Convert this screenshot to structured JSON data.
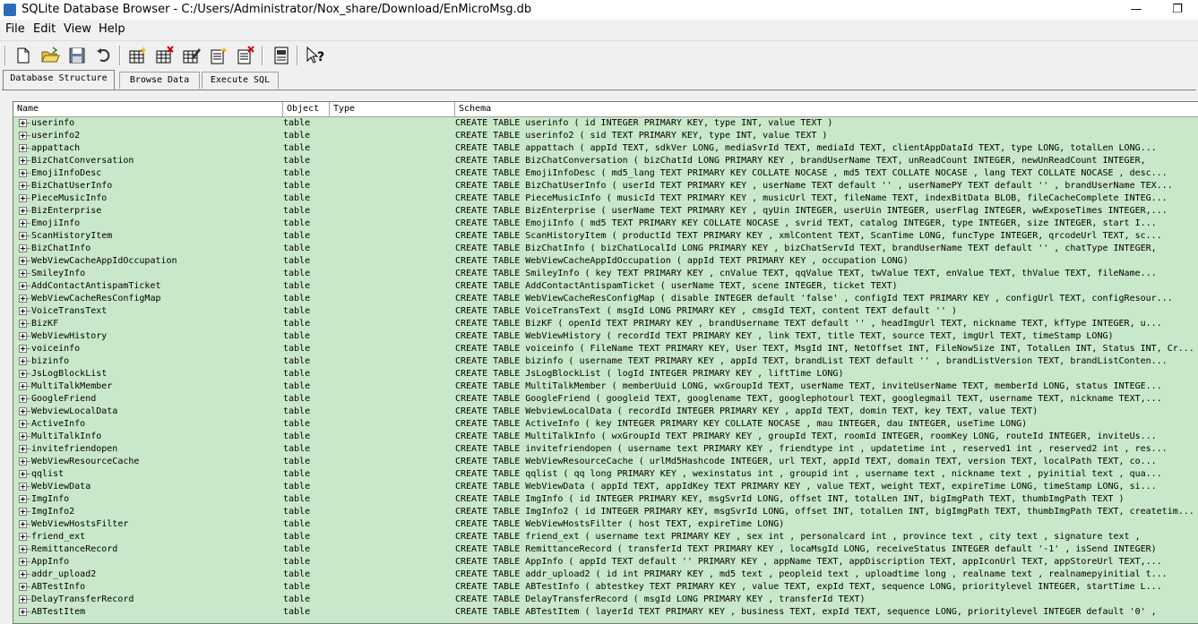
{
  "window": {
    "title": "SQLite Database Browser - C:/Users/Administrator/Nox_share/Download/EnMicroMsg.db",
    "minimize": "—",
    "restore": "❐"
  },
  "menu": {
    "file": "File",
    "edit": "Edit",
    "view": "View",
    "help": "Help"
  },
  "toolbar": {
    "icons": [
      "new-database-icon",
      "open-database-icon",
      "save-icon",
      "undo-icon",
      "create-table-icon",
      "delete-table-icon",
      "modify-table-icon",
      "create-index-icon",
      "delete-index-icon",
      "log-icon",
      "whats-this-icon"
    ]
  },
  "tabs": [
    "Database Structure",
    "Browse Data",
    "Execute SQL"
  ],
  "columns": {
    "name": "Name",
    "object": "Object",
    "type": "Type",
    "schema": "Schema"
  },
  "rows": [
    {
      "name": "userinfo",
      "object": "table",
      "schema": "CREATE TABLE userinfo ( id INTEGER PRIMARY KEY, type INT, value TEXT )"
    },
    {
      "name": "userinfo2",
      "object": "table",
      "schema": "CREATE TABLE userinfo2 ( sid TEXT PRIMARY KEY, type INT, value TEXT )"
    },
    {
      "name": "appattach",
      "object": "table",
      "schema": "CREATE TABLE appattach (  appId TEXT,  sdkVer LONG,  mediaSvrId TEXT,  mediaId TEXT,  clientAppDataId TEXT,  type LONG,  totalLen LONG..."
    },
    {
      "name": "BizChatConversation",
      "object": "table",
      "schema": "CREATE TABLE BizChatConversation (  bizChatId LONG PRIMARY KEY ,  brandUserName TEXT,  unReadCount INTEGER,  newUnReadCount INTEGER,"
    },
    {
      "name": "EmojiInfoDesc",
      "object": "table",
      "schema": "CREATE TABLE EmojiInfoDesc (  md5_lang TEXT PRIMARY KEY  COLLATE NOCASE ,  md5 TEXT COLLATE NOCASE ,  lang TEXT COLLATE NOCASE ,  desc..."
    },
    {
      "name": "BizChatUserInfo",
      "object": "table",
      "schema": "CREATE TABLE BizChatUserInfo (  userId TEXT PRIMARY KEY ,  userName TEXT default '' ,  userNamePY TEXT default '' ,  brandUserName TEX..."
    },
    {
      "name": "PieceMusicInfo",
      "object": "table",
      "schema": "CREATE TABLE PieceMusicInfo (  musicId TEXT PRIMARY KEY ,  musicUrl TEXT,  fileName TEXT,  indexBitData BLOB,  fileCacheComplete INTEG..."
    },
    {
      "name": "BizEnterprise",
      "object": "table",
      "schema": "CREATE TABLE BizEnterprise (  userName TEXT PRIMARY KEY ,  qyUin INTEGER,  userUin INTEGER,  userFlag INTEGER,  wwExposeTimes INTEGER,..."
    },
    {
      "name": "EmojiInfo",
      "object": "table",
      "schema": "CREATE TABLE EmojiInfo (  md5 TEXT PRIMARY KEY  COLLATE NOCASE ,  svrid TEXT,  catalog INTEGER,  type INTEGER,  size INTEGER,  start I..."
    },
    {
      "name": "ScanHistoryItem",
      "object": "table",
      "schema": "CREATE TABLE ScanHistoryItem (  productId TEXT PRIMARY KEY ,  xmlContent TEXT,  ScanTime LONG,  funcType INTEGER,  qrcodeUrl TEXT,  sc..."
    },
    {
      "name": "BizChatInfo",
      "object": "table",
      "schema": "CREATE TABLE BizChatInfo (  bizChatLocalId LONG PRIMARY KEY ,  bizChatServId TEXT,  brandUserName TEXT default '' ,  chatType INTEGER,"
    },
    {
      "name": "WebViewCacheAppIdOccupation",
      "object": "table",
      "schema": "CREATE TABLE WebViewCacheAppIdOccupation (  appId TEXT PRIMARY KEY ,  occupation LONG)"
    },
    {
      "name": "SmileyInfo",
      "object": "table",
      "schema": "CREATE TABLE SmileyInfo (  key TEXT PRIMARY KEY ,  cnValue TEXT,  qqValue TEXT,  twValue TEXT,  enValue TEXT,  thValue TEXT,  fileName..."
    },
    {
      "name": "AddContactAntispamTicket",
      "object": "table",
      "schema": "CREATE TABLE AddContactAntispamTicket (  userName TEXT,  scene INTEGER,  ticket TEXT)"
    },
    {
      "name": "WebViewCacheResConfigMap",
      "object": "table",
      "schema": "CREATE TABLE WebViewCacheResConfigMap (  disable INTEGER default 'false' ,  configId TEXT PRIMARY KEY ,  configUrl TEXT,  configResour..."
    },
    {
      "name": "VoiceTransText",
      "object": "table",
      "schema": "CREATE TABLE VoiceTransText (  msgId LONG PRIMARY KEY ,  cmsgId TEXT,  content TEXT default '' )"
    },
    {
      "name": "BizKF",
      "object": "table",
      "schema": "CREATE TABLE BizKF (  openId TEXT PRIMARY KEY ,  brandUsername TEXT default '' ,  headImgUrl TEXT,  nickname TEXT,  kfType INTEGER,  u..."
    },
    {
      "name": "WebViewHistory",
      "object": "table",
      "schema": "CREATE TABLE WebViewHistory (  recordId TEXT PRIMARY KEY ,  link TEXT,  title TEXT,  source TEXT,  imgUrl TEXT,  timeStamp LONG)"
    },
    {
      "name": "voiceinfo",
      "object": "table",
      "schema": "CREATE TABLE voiceinfo ( FileName TEXT PRIMARY KEY, User TEXT, MsgId INT, NetOffset INT, FileNowSize INT, TotalLen INT, Status INT, Cr..."
    },
    {
      "name": "bizinfo",
      "object": "table",
      "schema": "CREATE TABLE bizinfo (  username TEXT PRIMARY KEY ,  appId TEXT,  brandList TEXT default '' ,  brandListVersion TEXT,  brandListConten..."
    },
    {
      "name": "JsLogBlockList",
      "object": "table",
      "schema": "CREATE TABLE JsLogBlockList (  logId INTEGER PRIMARY KEY ,  liftTime LONG)"
    },
    {
      "name": "MultiTalkMember",
      "object": "table",
      "schema": "CREATE TABLE MultiTalkMember (  memberUuid LONG,  wxGroupId TEXT,  userName TEXT,  inviteUserName TEXT,  memberId LONG,  status INTEGE..."
    },
    {
      "name": "GoogleFriend",
      "object": "table",
      "schema": "CREATE TABLE GoogleFriend (  googleid TEXT,  googlename TEXT,  googlephotourl TEXT,  googlegmail TEXT,  username TEXT,  nickname TEXT,..."
    },
    {
      "name": "WebviewLocalData",
      "object": "table",
      "schema": "CREATE TABLE WebviewLocalData (  recordId INTEGER PRIMARY KEY ,  appId TEXT,  domin TEXT,  key TEXT,  value TEXT)"
    },
    {
      "name": "ActiveInfo",
      "object": "table",
      "schema": "CREATE TABLE ActiveInfo (  key INTEGER PRIMARY KEY  COLLATE NOCASE ,  mau INTEGER,  dau INTEGER,  useTime LONG)"
    },
    {
      "name": "MultiTalkInfo",
      "object": "table",
      "schema": "CREATE TABLE MultiTalkInfo (  wxGroupId TEXT PRIMARY KEY ,  groupId TEXT,  roomId INTEGER,  roomKey LONG,  routeId INTEGER,  inviteUs..."
    },
    {
      "name": "invitefriendopen",
      "object": "table",
      "schema": "CREATE TABLE invitefriendopen ( username text  PRIMARY KEY , friendtype int  , updatetime int , reserved1 int  , reserved2 int  , res..."
    },
    {
      "name": "WebViewResourceCache",
      "object": "table",
      "schema": "CREATE TABLE WebViewResourceCache (  urlMd5Hashcode INTEGER,  url TEXT,  appId TEXT,  domain TEXT,  version TEXT,  localPath TEXT,  co..."
    },
    {
      "name": "qqlist",
      "object": "table",
      "schema": "CREATE TABLE qqlist ( qq long  PRIMARY KEY , wexinstatus int  , groupid int  , username text  , nickname text  , pyinitial text  , qua..."
    },
    {
      "name": "WebViewData",
      "object": "table",
      "schema": "CREATE TABLE WebViewData (  appId TEXT,  appIdKey TEXT PRIMARY KEY ,  value TEXT,  weight TEXT,  expireTime LONG,  timeStamp LONG,  si..."
    },
    {
      "name": "ImgInfo",
      "object": "table",
      "schema": "CREATE TABLE ImgInfo ( id INTEGER PRIMARY KEY, msgSvrId LONG, offset INT, totalLen INT, bigImgPath TEXT, thumbImgPath TEXT )"
    },
    {
      "name": "ImgInfo2",
      "object": "table",
      "schema": "CREATE TABLE ImgInfo2 ( id INTEGER PRIMARY KEY, msgSvrId LONG, offset INT, totalLen INT, bigImgPath TEXT, thumbImgPath TEXT, createtim..."
    },
    {
      "name": "WebViewHostsFilter",
      "object": "table",
      "schema": "CREATE TABLE WebViewHostsFilter (  host TEXT,  expireTime LONG)"
    },
    {
      "name": "friend_ext",
      "object": "table",
      "schema": "CREATE TABLE friend_ext ( username text  PRIMARY KEY , sex int  , personalcard int  , province text  , city text  , signature text  ,"
    },
    {
      "name": "RemittanceRecord",
      "object": "table",
      "schema": "CREATE TABLE RemittanceRecord (  transferId TEXT PRIMARY KEY ,  locaMsgId LONG,  receiveStatus INTEGER default '-1' ,  isSend INTEGER)"
    },
    {
      "name": "AppInfo",
      "object": "table",
      "schema": "CREATE TABLE AppInfo (  appId TEXT default ''  PRIMARY KEY ,  appName TEXT,  appDiscription TEXT,  appIconUrl TEXT,  appStoreUrl TEXT,..."
    },
    {
      "name": "addr_upload2",
      "object": "table",
      "schema": "CREATE TABLE addr_upload2 ( id int  PRIMARY KEY , md5 text  , peopleid text  , uploadtime long  , realname text  , realnamepyinitial t..."
    },
    {
      "name": "ABTestInfo",
      "object": "table",
      "schema": "CREATE TABLE ABTestInfo (  abtestkey TEXT PRIMARY KEY ,  value TEXT,  expId TEXT,  sequence LONG,  prioritylevel INTEGER,  startTime L..."
    },
    {
      "name": "DelayTransferRecord",
      "object": "table",
      "schema": "CREATE TABLE DelayTransferRecord (  msgId LONG PRIMARY KEY ,  transferId TEXT)"
    },
    {
      "name": "ABTestItem",
      "object": "table",
      "schema": "CREATE TABLE ABTestItem (  layerId TEXT PRIMARY KEY ,  business TEXT,  expId TEXT,  sequence LONG,  prioritylevel INTEGER default '0' ,"
    }
  ]
}
